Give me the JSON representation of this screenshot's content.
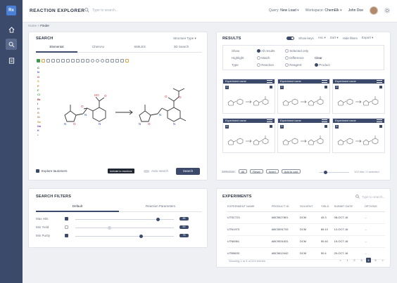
{
  "app": {
    "logo": "Rx",
    "title": "REACTION EXPLORER"
  },
  "topbar": {
    "search_placeholder": "Type to search...",
    "query_label": "Query:",
    "query_value": "New Load",
    "workspace_label": "Workspace:",
    "workspace_value": "ChemElk",
    "user": "John Doe"
  },
  "breadcrumb": {
    "home": "Home",
    "sep": ">",
    "current": "Finder"
  },
  "search": {
    "title": "SEARCH",
    "structure_type": "Structure Type",
    "tabs": [
      "Elemental",
      "ChemAx",
      "SMILES",
      "3D Search"
    ],
    "elements": [
      "C",
      "N",
      "O",
      "S",
      "P",
      "F",
      "Cl",
      "Br",
      "I",
      "H",
      "B",
      "Si",
      "Se",
      "Na",
      "K",
      "*"
    ],
    "explore_label": "Explore tautomers",
    "tooltip": "Activate to reactions",
    "auto_label": "Auto search",
    "search_button": "Search"
  },
  "results": {
    "title": "RESULTS",
    "show_keys": "Show keys",
    "asc": "Asc",
    "sort": "Sort",
    "hide_filters": "Hide filters",
    "export": "Export",
    "show_label": "Show",
    "show_all": "All results",
    "show_selected": "Selected only",
    "highlight_label": "Highlight",
    "highlight_match": "Match",
    "highlight_diff": "Difference",
    "highlight_clear": "Clear",
    "type_label": "Type",
    "type_reaction": "Reaction",
    "type_reagent": "Reagent",
    "type_product": "Product",
    "card_title": "Experiment name",
    "selection_label": "Selection:",
    "sel_all": "All",
    "sel_reset": "Reset",
    "sel_invert": "Invert",
    "sel_add": "Add to cart",
    "count_text": "103 hits / 0 selected"
  },
  "filters": {
    "title": "SEARCH FILTERS",
    "tabs": [
      "Default",
      "Reaction Parameters"
    ],
    "rows": [
      {
        "label": "Max Hits",
        "value": "85"
      },
      {
        "label": "Min Yield",
        "value": "50"
      },
      {
        "label": "Min Purity",
        "value": "75"
      }
    ]
  },
  "experiments": {
    "title": "EXPERIMENTS",
    "search_placeholder": "Type to search...",
    "columns": [
      "EXPERIMENT NAME",
      "PRODUCT ID",
      "SOLVENT",
      "YIELD",
      "SUBMIT DATE",
      "OPTIONS"
    ],
    "rows": [
      [
        "UTSC723",
        "ABC5627801",
        "DCM",
        "45.3",
        "08-OCT-16",
        "..."
      ],
      [
        "UTN1973",
        "ABC5591733",
        "DCM",
        "85.10",
        "12-OCT-16",
        "..."
      ],
      [
        "UTN8361",
        "ABC9531631",
        "DCM",
        "50.40",
        "19-OCT-16",
        "..."
      ],
      [
        "UTB9833",
        "ABC5612442",
        "DCM",
        "50.4",
        "20-OCT-16",
        "..."
      ]
    ],
    "footer": "Showing 1 to 5 of 224 entries",
    "pages": [
      "<",
      "1",
      "2",
      "3",
      "4",
      "5",
      ">"
    ]
  }
}
